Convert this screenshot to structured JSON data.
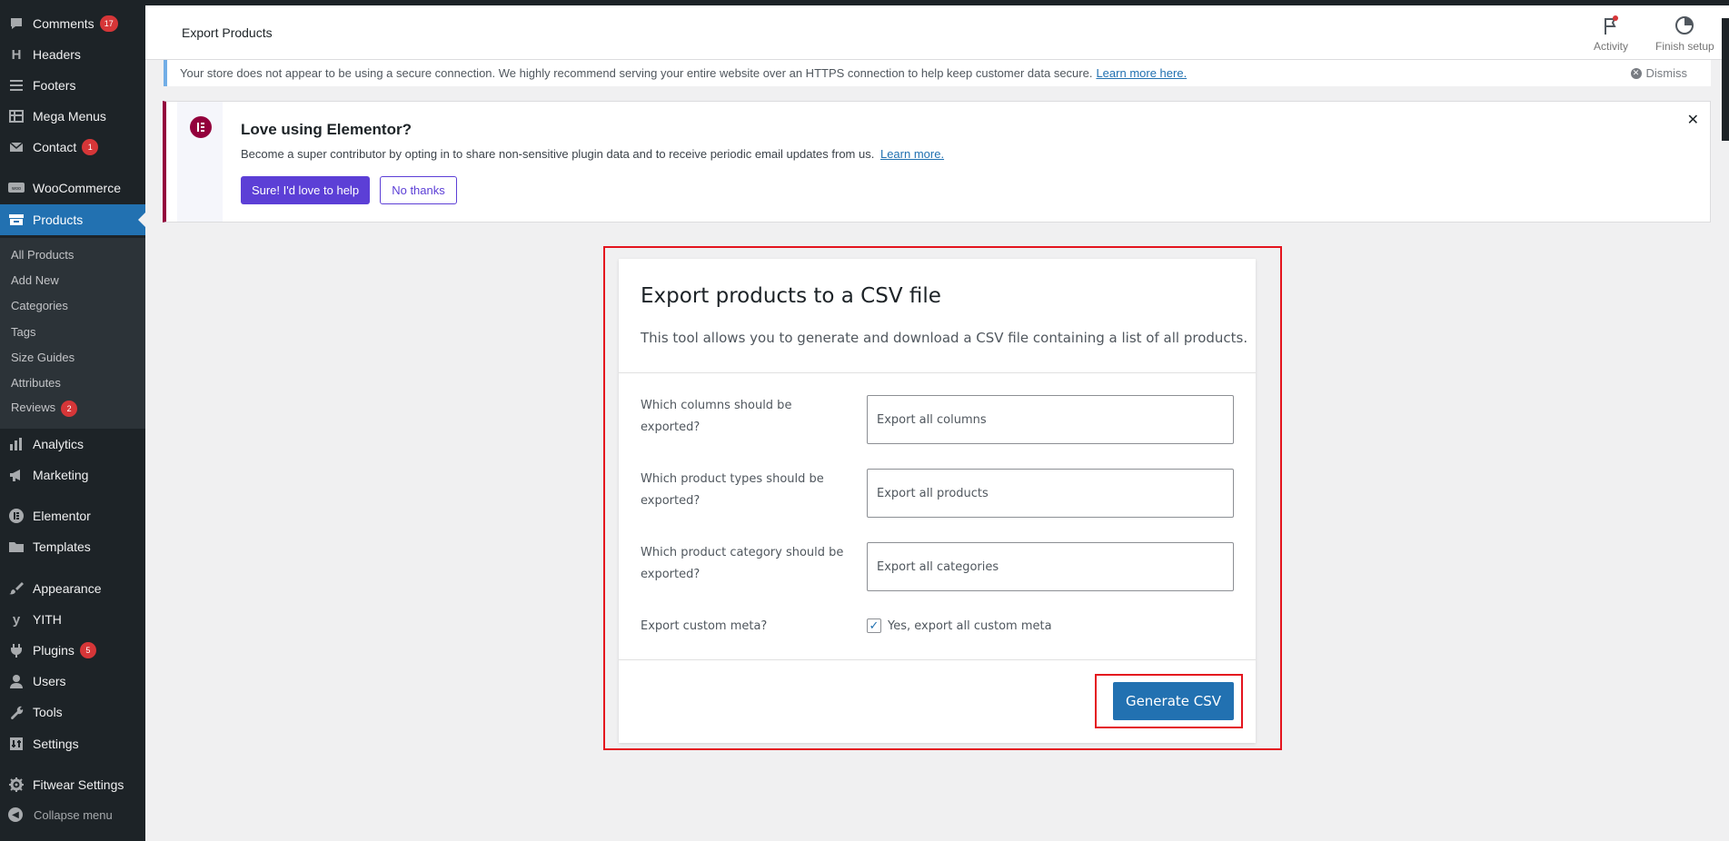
{
  "sidebar": {
    "items": [
      {
        "label": "Comments",
        "icon": "comment-icon",
        "badge": "17",
        "active": false
      },
      {
        "label": "Headers",
        "icon": "headers-icon",
        "badge": "",
        "active": false
      },
      {
        "label": "Footers",
        "icon": "footers-icon",
        "badge": "",
        "active": false
      },
      {
        "label": "Mega Menus",
        "icon": "mega-menus-icon",
        "badge": "",
        "active": false
      },
      {
        "label": "Contact",
        "icon": "mail-icon",
        "badge": "1",
        "active": false
      },
      {
        "label": "WooCommerce",
        "icon": "woocommerce-icon",
        "badge": "",
        "active": false
      },
      {
        "label": "Products",
        "icon": "archive-icon",
        "badge": "",
        "active": true
      },
      {
        "label": "Analytics",
        "icon": "bar-chart-icon",
        "badge": "",
        "active": false
      },
      {
        "label": "Marketing",
        "icon": "megaphone-icon",
        "badge": "",
        "active": false
      },
      {
        "label": "Elementor",
        "icon": "elementor-icon",
        "badge": "",
        "active": false
      },
      {
        "label": "Templates",
        "icon": "folder-icon",
        "badge": "",
        "active": false
      },
      {
        "label": "Appearance",
        "icon": "paintbrush-icon",
        "badge": "",
        "active": false
      },
      {
        "label": "YITH",
        "icon": "yith-icon",
        "badge": "",
        "active": false
      },
      {
        "label": "Plugins",
        "icon": "plugin-icon",
        "badge": "5",
        "active": false
      },
      {
        "label": "Users",
        "icon": "user-icon",
        "badge": "",
        "active": false
      },
      {
        "label": "Tools",
        "icon": "wrench-icon",
        "badge": "",
        "active": false
      },
      {
        "label": "Settings",
        "icon": "settings-icon",
        "badge": "",
        "active": false
      },
      {
        "label": "Fitwear Settings",
        "icon": "gear-icon",
        "badge": "",
        "active": false
      }
    ],
    "submenu": [
      {
        "label": "All Products",
        "badge": ""
      },
      {
        "label": "Add New",
        "badge": ""
      },
      {
        "label": "Categories",
        "badge": ""
      },
      {
        "label": "Tags",
        "badge": ""
      },
      {
        "label": "Size Guides",
        "badge": ""
      },
      {
        "label": "Attributes",
        "badge": ""
      },
      {
        "label": "Reviews",
        "badge": "2"
      }
    ],
    "collapse_label": "Collapse menu"
  },
  "header": {
    "title": "Export Products",
    "activity_label": "Activity",
    "finish_setup_label": "Finish setup"
  },
  "https_notice": {
    "text": "Your store does not appear to be using a secure connection. We highly recommend serving your entire website over an HTTPS connection to help keep customer data secure.",
    "link": "Learn more here.",
    "dismiss": "Dismiss"
  },
  "elementor_notice": {
    "title": "Love using Elementor?",
    "text": "Become a super contributor by opting in to share non-sensitive plugin data and to receive periodic email updates from us.",
    "link": "Learn more.",
    "primary_button": "Sure! I'd love to help",
    "secondary_button": "No thanks"
  },
  "export": {
    "title": "Export products to a CSV file",
    "description": "This tool allows you to generate and download a CSV file containing a list of all products.",
    "fields": [
      {
        "label": "Which columns should be exported?",
        "value": "Export all columns"
      },
      {
        "label": "Which product types should be exported?",
        "value": "Export all products"
      },
      {
        "label": "Which product category should be exported?",
        "value": "Export all categories"
      }
    ],
    "custom_meta_label": "Export custom meta?",
    "custom_meta_checkbox": "Yes, export all custom meta",
    "custom_meta_checked": true,
    "generate_button": "Generate CSV"
  },
  "colors": {
    "sidebar_bg": "#1d2327",
    "active_blue": "#2271b1",
    "elementor_accent": "#93003c",
    "elementor_button": "#5c3fd6",
    "highlight_red": "#e4141e"
  }
}
